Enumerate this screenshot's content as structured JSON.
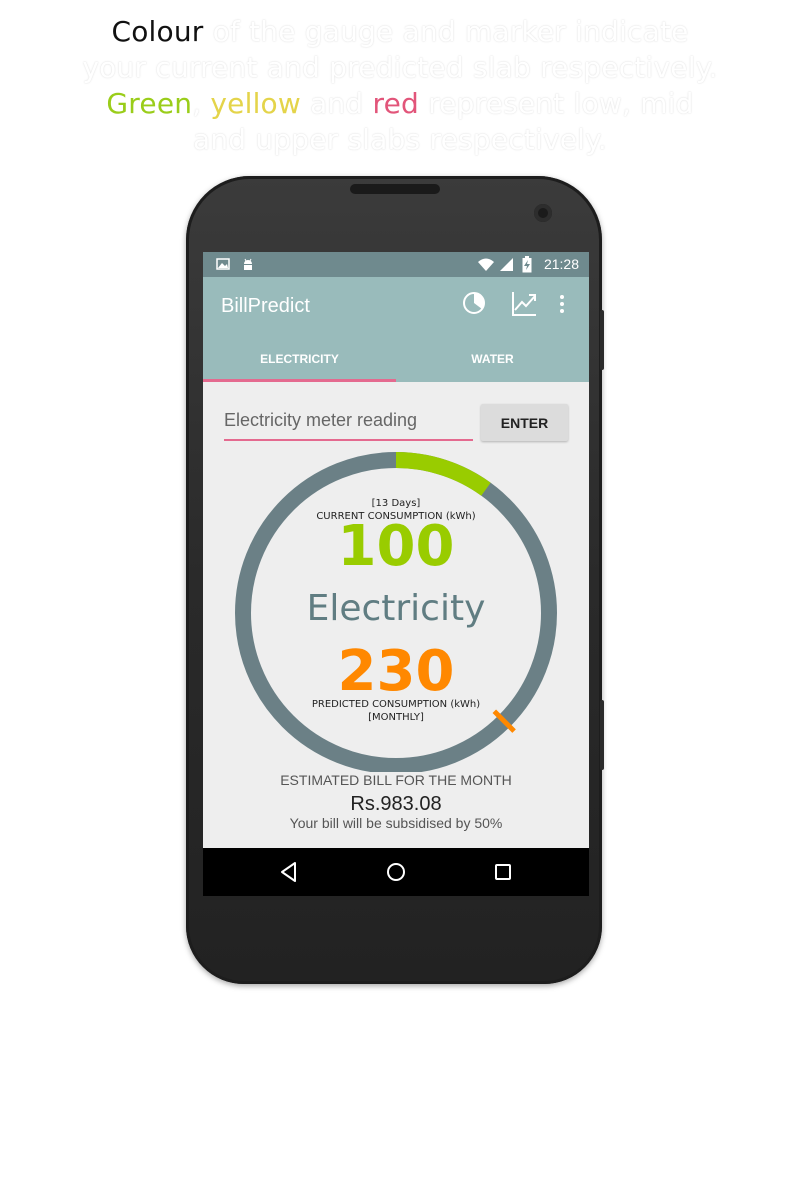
{
  "caption": {
    "line1_lead": "Colour",
    "line1_rest": " of the gauge and marker indicate",
    "line2": "your current and predicted slab respectively.",
    "line3_green": "Green",
    "line3_sep1": ", ",
    "line3_yellow": "yellow",
    "line3_sep2": " and ",
    "line3_red": "red",
    "line3_rest": " represent low, mid",
    "line4": "and upper slabs respectively."
  },
  "status_bar": {
    "time": "21:28",
    "icons": [
      "image-icon",
      "android-icon",
      "wifi-icon",
      "signal-icon",
      "battery-charging-icon"
    ]
  },
  "app_bar": {
    "title": "BillPredict",
    "actions": [
      "pie-chart-icon",
      "trend-chart-icon",
      "overflow-menu-icon"
    ]
  },
  "tabs": [
    {
      "label": "ELECTRICITY",
      "selected": true
    },
    {
      "label": "WATER",
      "selected": false
    }
  ],
  "meter_input": {
    "placeholder": "Electricity meter reading",
    "value": ""
  },
  "enter_button": "ENTER",
  "gauge": {
    "current_period": "[13 Days]",
    "current_label": "CURRENT CONSUMPTION (kWh)",
    "current_value": "100",
    "center_label": "Electricity",
    "predicted_value": "230",
    "predicted_label": "PREDICTED CONSUMPTION (kWh)",
    "predicted_period": "[MONTHLY]",
    "current_fraction": 0.1,
    "predicted_fraction": 0.375,
    "colors": {
      "track": "#6b8086",
      "current": "#99cc00",
      "predicted": "#ff8800",
      "low": "#99cc00",
      "mid": "#e4d44a",
      "high": "#e2557a"
    }
  },
  "estimate": {
    "label": "ESTIMATED BILL FOR THE MONTH",
    "amount": "Rs.983.08",
    "subsidy_note": "Your bill will be subsidised by 50%"
  },
  "nav_bar": [
    "back-icon",
    "home-icon",
    "recents-icon"
  ]
}
